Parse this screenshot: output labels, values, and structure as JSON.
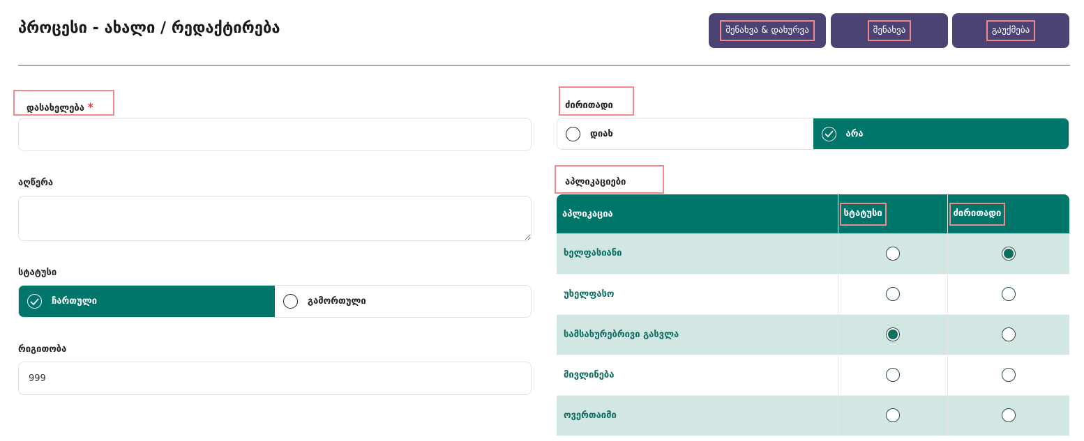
{
  "page": {
    "title": "პროცესი - ახალი / რედაქტირება"
  },
  "toolbar": {
    "save_close_label": "შენახვა & დახურვა",
    "save_label": "შენახვა",
    "cancel_label": "გაუქმება"
  },
  "form": {
    "name": {
      "label": "დასახელება",
      "required_mark": "*",
      "value": ""
    },
    "description": {
      "label": "აღწერა",
      "value": ""
    },
    "status": {
      "label": "სტატუსი",
      "options": [
        "ჩართული",
        "გამორთული"
      ],
      "selected": "ჩართული"
    },
    "order": {
      "label": "რიგითობა",
      "value": "999"
    },
    "main": {
      "label": "ძირითადი",
      "options": [
        "დიახ",
        "არა"
      ],
      "selected": "არა"
    }
  },
  "applications": {
    "label": "აპლიკაციები",
    "columns": [
      "აპლიკაცია",
      "სტატუსი",
      "ძირითადი"
    ],
    "rows": [
      {
        "name": "ხელფასიანი",
        "status": false,
        "main": true
      },
      {
        "name": "უხელფასო",
        "status": false,
        "main": false
      },
      {
        "name": "სამსახურებრივი გასვლა",
        "status": true,
        "main": false
      },
      {
        "name": "მივლინება",
        "status": false,
        "main": false
      },
      {
        "name": "ოვერთაიმი",
        "status": false,
        "main": false
      }
    ]
  },
  "colors": {
    "accent": "#00756a",
    "button": "#4a4373",
    "highlight": "#f08a8a",
    "row_shade": "#d2e6e4"
  }
}
